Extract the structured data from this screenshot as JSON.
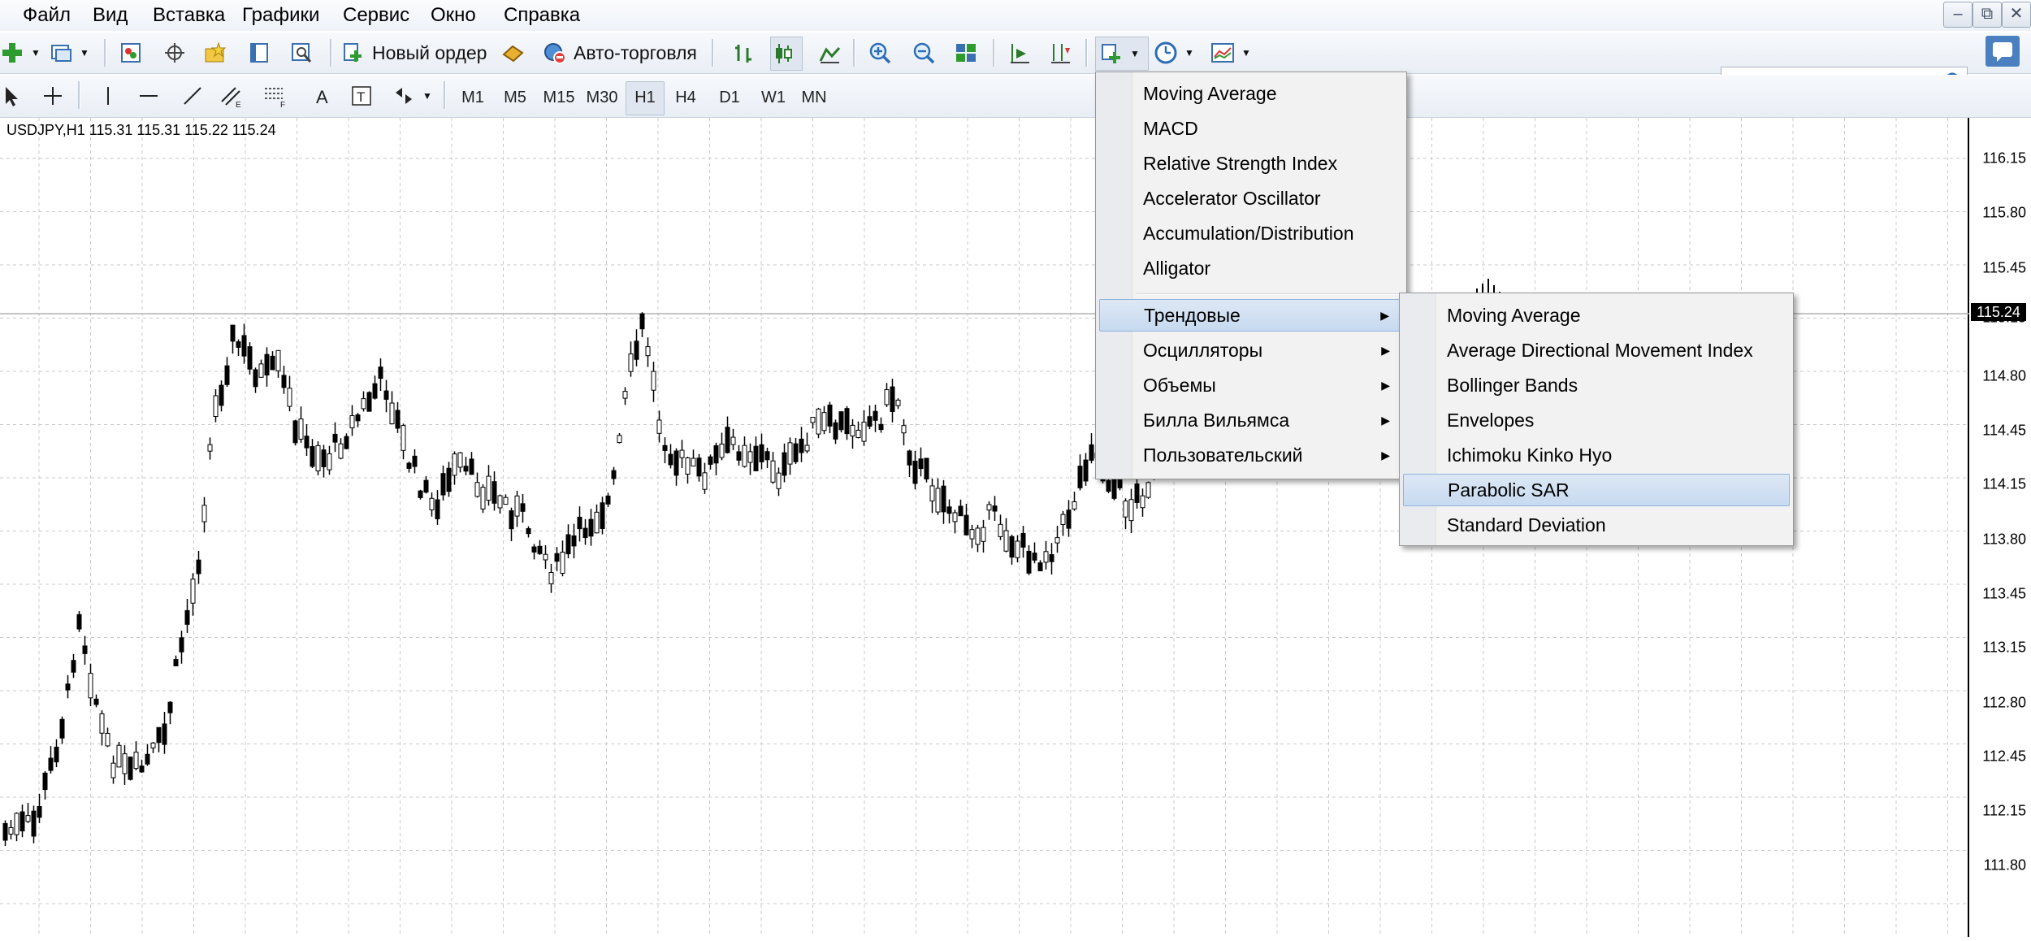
{
  "menubar": {
    "items": [
      "Файл",
      "Вид",
      "Вставка",
      "Графики",
      "Сервис",
      "Окно",
      "Справка"
    ]
  },
  "window_controls": {
    "minimize": "–",
    "restore": "⧉",
    "close": "✕"
  },
  "toolbar": {
    "new_order": "Новый ордер",
    "autotrading": "Авто-торговля",
    "search_placeholder": ""
  },
  "timeframes": [
    "M1",
    "M5",
    "M15",
    "M30",
    "H1",
    "H4",
    "D1",
    "W1",
    "MN"
  ],
  "active_timeframe": "H1",
  "chart": {
    "symbol_info": "USDJPY,H1  115.31 115.31 115.22 115.24",
    "current_price": "115.24",
    "price_labels": [
      "116.15",
      "115.80",
      "115.45",
      "115.15",
      "114.80",
      "114.45",
      "114.15",
      "113.80",
      "113.45",
      "113.15",
      "112.80",
      "112.45",
      "112.15",
      "111.80"
    ]
  },
  "indicators_menu": {
    "items": [
      "Moving Average",
      "MACD",
      "Relative Strength Index",
      "Accelerator Oscillator",
      "Accumulation/Distribution",
      "Alligator"
    ],
    "groups": [
      "Трендовые",
      "Осцилляторы",
      "Объемы",
      "Билла Вильямса",
      "Пользовательский"
    ],
    "highlighted_group": "Трендовые"
  },
  "trend_submenu": {
    "items": [
      "Moving Average",
      "Average Directional Movement Index",
      "Bollinger Bands",
      "Envelopes",
      "Ichimoku Kinko Hyo",
      "Parabolic SAR",
      "Standard Deviation"
    ],
    "highlighted": "Parabolic SAR"
  },
  "colors": {
    "highlight_bg": "#c7daf0",
    "grid": "#c8c8c8",
    "toolbar_bg": "#eef2f8"
  }
}
